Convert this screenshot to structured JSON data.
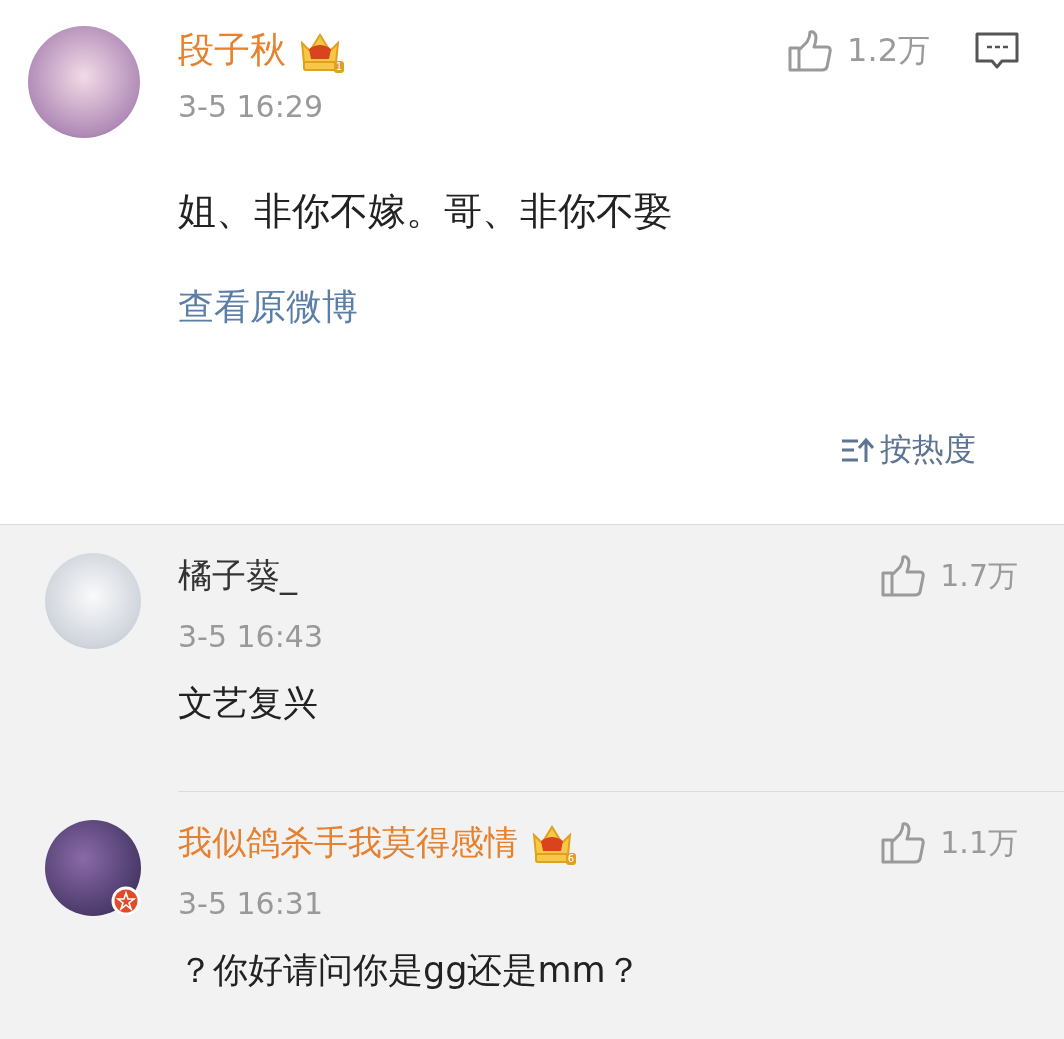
{
  "post": {
    "author": "段子秋",
    "vip": true,
    "vip_level": "1",
    "verified": false,
    "time": "3-5 16:29",
    "likes": "1.2万",
    "content": "姐、非你不嫁。哥、非你不娶",
    "link": "查看原微博"
  },
  "sort": {
    "label": "按热度"
  },
  "replies": [
    {
      "author": "橘子葵_",
      "vip": false,
      "verified": false,
      "time": "3-5 16:43",
      "likes": "1.7万",
      "content": "文艺复兴"
    },
    {
      "author": "我似鸽杀手我莫得感情",
      "vip": true,
      "vip_level": "6",
      "verified": true,
      "time": "3-5 16:31",
      "likes": "1.1万",
      "content": "？你好请问你是gg还是mm？"
    }
  ]
}
